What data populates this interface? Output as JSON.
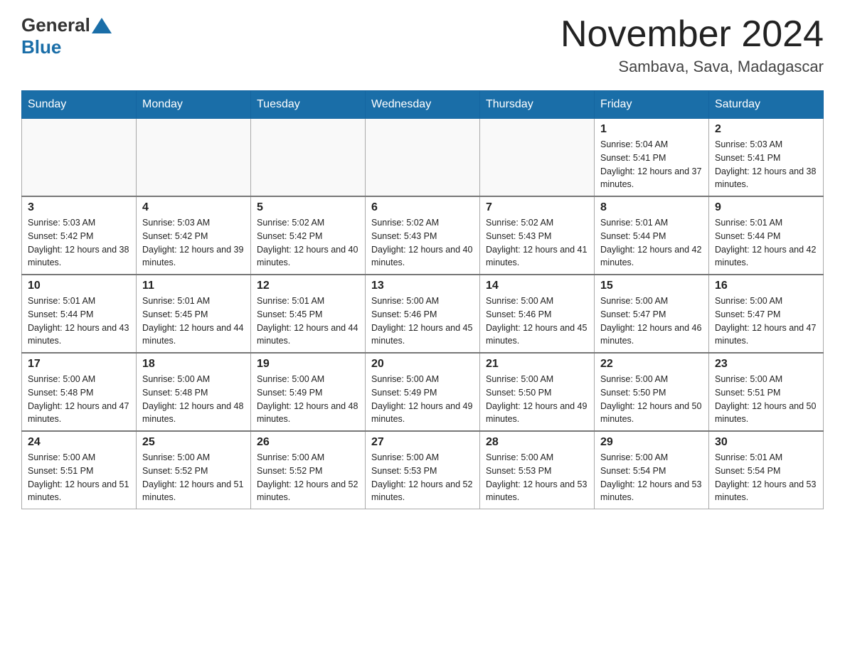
{
  "logo": {
    "general": "General",
    "blue": "Blue"
  },
  "title": "November 2024",
  "location": "Sambava, Sava, Madagascar",
  "weekdays": [
    "Sunday",
    "Monday",
    "Tuesday",
    "Wednesday",
    "Thursday",
    "Friday",
    "Saturday"
  ],
  "weeks": [
    [
      {
        "day": "",
        "sunrise": "",
        "sunset": "",
        "daylight": ""
      },
      {
        "day": "",
        "sunrise": "",
        "sunset": "",
        "daylight": ""
      },
      {
        "day": "",
        "sunrise": "",
        "sunset": "",
        "daylight": ""
      },
      {
        "day": "",
        "sunrise": "",
        "sunset": "",
        "daylight": ""
      },
      {
        "day": "",
        "sunrise": "",
        "sunset": "",
        "daylight": ""
      },
      {
        "day": "1",
        "sunrise": "Sunrise: 5:04 AM",
        "sunset": "Sunset: 5:41 PM",
        "daylight": "Daylight: 12 hours and 37 minutes."
      },
      {
        "day": "2",
        "sunrise": "Sunrise: 5:03 AM",
        "sunset": "Sunset: 5:41 PM",
        "daylight": "Daylight: 12 hours and 38 minutes."
      }
    ],
    [
      {
        "day": "3",
        "sunrise": "Sunrise: 5:03 AM",
        "sunset": "Sunset: 5:42 PM",
        "daylight": "Daylight: 12 hours and 38 minutes."
      },
      {
        "day": "4",
        "sunrise": "Sunrise: 5:03 AM",
        "sunset": "Sunset: 5:42 PM",
        "daylight": "Daylight: 12 hours and 39 minutes."
      },
      {
        "day": "5",
        "sunrise": "Sunrise: 5:02 AM",
        "sunset": "Sunset: 5:42 PM",
        "daylight": "Daylight: 12 hours and 40 minutes."
      },
      {
        "day": "6",
        "sunrise": "Sunrise: 5:02 AM",
        "sunset": "Sunset: 5:43 PM",
        "daylight": "Daylight: 12 hours and 40 minutes."
      },
      {
        "day": "7",
        "sunrise": "Sunrise: 5:02 AM",
        "sunset": "Sunset: 5:43 PM",
        "daylight": "Daylight: 12 hours and 41 minutes."
      },
      {
        "day": "8",
        "sunrise": "Sunrise: 5:01 AM",
        "sunset": "Sunset: 5:44 PM",
        "daylight": "Daylight: 12 hours and 42 minutes."
      },
      {
        "day": "9",
        "sunrise": "Sunrise: 5:01 AM",
        "sunset": "Sunset: 5:44 PM",
        "daylight": "Daylight: 12 hours and 42 minutes."
      }
    ],
    [
      {
        "day": "10",
        "sunrise": "Sunrise: 5:01 AM",
        "sunset": "Sunset: 5:44 PM",
        "daylight": "Daylight: 12 hours and 43 minutes."
      },
      {
        "day": "11",
        "sunrise": "Sunrise: 5:01 AM",
        "sunset": "Sunset: 5:45 PM",
        "daylight": "Daylight: 12 hours and 44 minutes."
      },
      {
        "day": "12",
        "sunrise": "Sunrise: 5:01 AM",
        "sunset": "Sunset: 5:45 PM",
        "daylight": "Daylight: 12 hours and 44 minutes."
      },
      {
        "day": "13",
        "sunrise": "Sunrise: 5:00 AM",
        "sunset": "Sunset: 5:46 PM",
        "daylight": "Daylight: 12 hours and 45 minutes."
      },
      {
        "day": "14",
        "sunrise": "Sunrise: 5:00 AM",
        "sunset": "Sunset: 5:46 PM",
        "daylight": "Daylight: 12 hours and 45 minutes."
      },
      {
        "day": "15",
        "sunrise": "Sunrise: 5:00 AM",
        "sunset": "Sunset: 5:47 PM",
        "daylight": "Daylight: 12 hours and 46 minutes."
      },
      {
        "day": "16",
        "sunrise": "Sunrise: 5:00 AM",
        "sunset": "Sunset: 5:47 PM",
        "daylight": "Daylight: 12 hours and 47 minutes."
      }
    ],
    [
      {
        "day": "17",
        "sunrise": "Sunrise: 5:00 AM",
        "sunset": "Sunset: 5:48 PM",
        "daylight": "Daylight: 12 hours and 47 minutes."
      },
      {
        "day": "18",
        "sunrise": "Sunrise: 5:00 AM",
        "sunset": "Sunset: 5:48 PM",
        "daylight": "Daylight: 12 hours and 48 minutes."
      },
      {
        "day": "19",
        "sunrise": "Sunrise: 5:00 AM",
        "sunset": "Sunset: 5:49 PM",
        "daylight": "Daylight: 12 hours and 48 minutes."
      },
      {
        "day": "20",
        "sunrise": "Sunrise: 5:00 AM",
        "sunset": "Sunset: 5:49 PM",
        "daylight": "Daylight: 12 hours and 49 minutes."
      },
      {
        "day": "21",
        "sunrise": "Sunrise: 5:00 AM",
        "sunset": "Sunset: 5:50 PM",
        "daylight": "Daylight: 12 hours and 49 minutes."
      },
      {
        "day": "22",
        "sunrise": "Sunrise: 5:00 AM",
        "sunset": "Sunset: 5:50 PM",
        "daylight": "Daylight: 12 hours and 50 minutes."
      },
      {
        "day": "23",
        "sunrise": "Sunrise: 5:00 AM",
        "sunset": "Sunset: 5:51 PM",
        "daylight": "Daylight: 12 hours and 50 minutes."
      }
    ],
    [
      {
        "day": "24",
        "sunrise": "Sunrise: 5:00 AM",
        "sunset": "Sunset: 5:51 PM",
        "daylight": "Daylight: 12 hours and 51 minutes."
      },
      {
        "day": "25",
        "sunrise": "Sunrise: 5:00 AM",
        "sunset": "Sunset: 5:52 PM",
        "daylight": "Daylight: 12 hours and 51 minutes."
      },
      {
        "day": "26",
        "sunrise": "Sunrise: 5:00 AM",
        "sunset": "Sunset: 5:52 PM",
        "daylight": "Daylight: 12 hours and 52 minutes."
      },
      {
        "day": "27",
        "sunrise": "Sunrise: 5:00 AM",
        "sunset": "Sunset: 5:53 PM",
        "daylight": "Daylight: 12 hours and 52 minutes."
      },
      {
        "day": "28",
        "sunrise": "Sunrise: 5:00 AM",
        "sunset": "Sunset: 5:53 PM",
        "daylight": "Daylight: 12 hours and 53 minutes."
      },
      {
        "day": "29",
        "sunrise": "Sunrise: 5:00 AM",
        "sunset": "Sunset: 5:54 PM",
        "daylight": "Daylight: 12 hours and 53 minutes."
      },
      {
        "day": "30",
        "sunrise": "Sunrise: 5:01 AM",
        "sunset": "Sunset: 5:54 PM",
        "daylight": "Daylight: 12 hours and 53 minutes."
      }
    ]
  ]
}
